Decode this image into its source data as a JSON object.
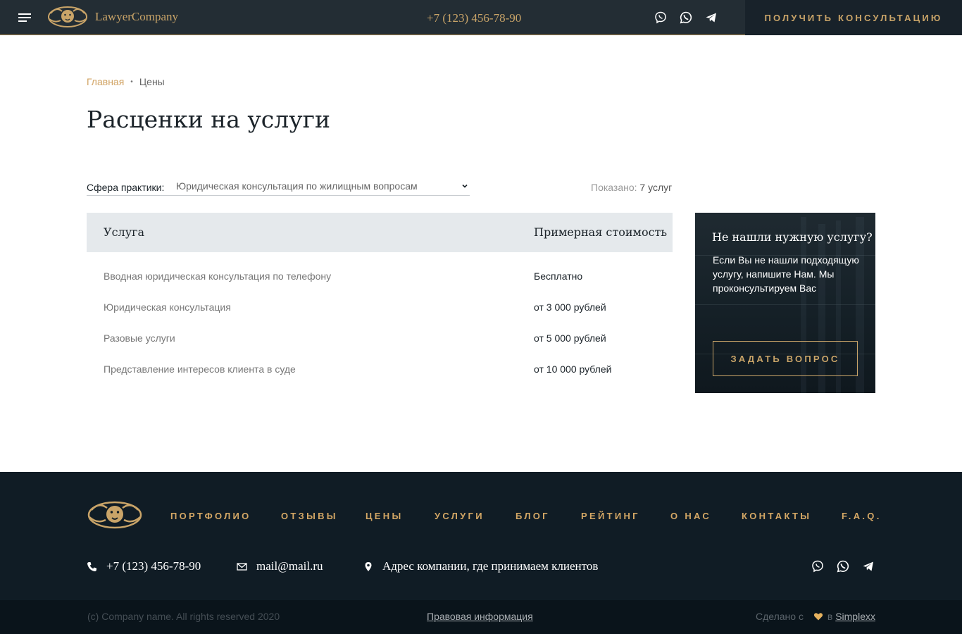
{
  "header": {
    "logo_text": "LawyerCompany",
    "phone": "+7 (123) 456-78-90",
    "cta_label": "ПОЛУЧИТЬ КОНСУЛЬТАЦИЮ"
  },
  "breadcrumb": {
    "home": "Главная",
    "separator": "•",
    "current": "Цены"
  },
  "page_title": "Расценки на услуги",
  "filter": {
    "label": "Сфера практики:",
    "selected": "Юридическая консультация по жилищным вопросам",
    "shown_label": "Показано:",
    "shown_value": "7 услуг"
  },
  "table": {
    "headers": [
      "Услуга",
      "Примерная стоимость"
    ],
    "rows": [
      {
        "service": "Вводная юридическая консультация по телефону",
        "price": "Бесплатно"
      },
      {
        "service": "Юридическая консультация",
        "price": "от 3 000 рублей"
      },
      {
        "service": "Разовые услуги",
        "price": "от 5 000 рублей"
      },
      {
        "service": "Представление интересов клиента в суде",
        "price": "от 10 000 рублей"
      }
    ]
  },
  "card": {
    "title": "Не нашли нужную услугу?",
    "text": "Если Вы не нашли подходящую услугу, напишите Нам. Мы проконсультируем Вас",
    "button": "ЗАДАТЬ ВОПРОС"
  },
  "footer": {
    "nav": [
      "ПОРТФОЛИО",
      "ОТЗЫВЫ",
      "ЦЕНЫ",
      "УСЛУГИ",
      "БЛОГ",
      "РЕЙТИНГ",
      "О НАС",
      "КОНТАКТЫ",
      "F.A.Q."
    ],
    "phone": "+7 (123) 456-78-90",
    "email": "mail@mail.ru",
    "address": "Адрес компании, где принимаем клиентов",
    "copyright": "(c) Company name. All rights reserved 2020",
    "legal": "Правовая информация",
    "made_with_prefix": "Сделано с",
    "made_with_in": "в",
    "made_with_brand": "Simplexx"
  },
  "icons": [
    "menu-icon",
    "lion-logo-icon",
    "viber-icon",
    "whatsapp-icon",
    "telegram-icon",
    "chevron-down-icon",
    "phone-icon",
    "mail-icon",
    "location-pin-icon",
    "heart-icon"
  ],
  "colors": {
    "gold": "#c9a468",
    "dark_header": "#232d34",
    "footer_bg": "#101c25",
    "table_head": "#e5e9ec"
  }
}
